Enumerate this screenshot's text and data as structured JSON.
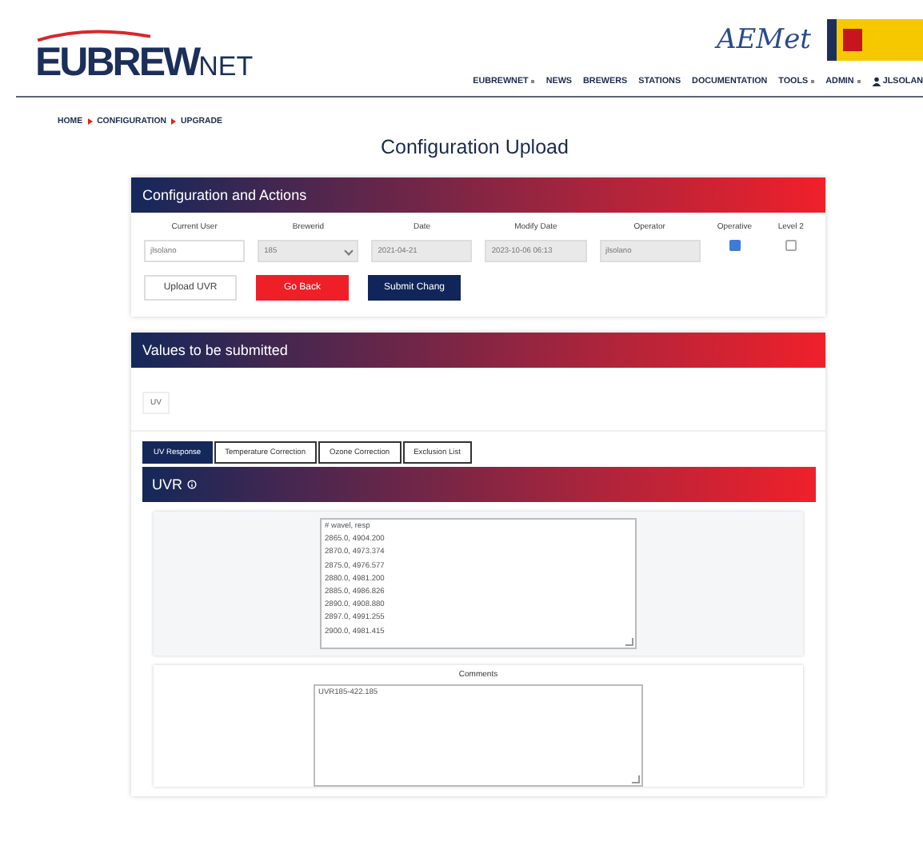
{
  "header": {
    "logo_main": "EUBREW",
    "logo_suffix": "NET",
    "partner_logo": "AEMet",
    "nav": [
      {
        "label": "EUBREWNET",
        "dropdown": true
      },
      {
        "label": "NEWS",
        "dropdown": false
      },
      {
        "label": "BREWERS",
        "dropdown": false
      },
      {
        "label": "STATIONS",
        "dropdown": false
      },
      {
        "label": "DOCUMENTATION",
        "dropdown": false
      },
      {
        "label": "TOOLS",
        "dropdown": true
      },
      {
        "label": "ADMIN",
        "dropdown": true
      }
    ],
    "user": "JLSOLAN"
  },
  "breadcrumb": [
    "HOME",
    "CONFIGURATION",
    "UPGRADE"
  ],
  "page_title": "Configuration Upload",
  "config_card": {
    "title": "Configuration and Actions",
    "fields": [
      {
        "kind": "input",
        "label": "Current User",
        "value": "jlsolano",
        "disabled": false
      },
      {
        "kind": "select",
        "label": "Brewerid",
        "value": "185",
        "disabled": true
      },
      {
        "kind": "input",
        "label": "Date",
        "value": "2021-04-21",
        "disabled": true
      },
      {
        "kind": "input",
        "label": "Modify Date",
        "value": "2023-10-06 06:13",
        "disabled": true
      },
      {
        "kind": "input",
        "label": "Operator",
        "value": "jlsolano",
        "disabled": true
      },
      {
        "kind": "checkbox",
        "label": "Operative",
        "checked": true
      },
      {
        "kind": "checkbox",
        "label": "Level 2",
        "checked": false
      }
    ],
    "buttons": [
      {
        "label": "Upload UVR",
        "kind": "outline"
      },
      {
        "label": "Go Back",
        "kind": "danger"
      },
      {
        "label": "Submit Chang",
        "kind": "primary"
      }
    ]
  },
  "values_card": {
    "title": "Values to be submitted",
    "chip": "UV",
    "tabs": [
      {
        "label": "UV Response",
        "selected": true
      },
      {
        "label": "Temperature Correction",
        "selected": false
      },
      {
        "label": "Ozone Correction",
        "selected": false
      },
      {
        "label": "Exclusion List",
        "selected": false
      }
    ],
    "section_title": "UVR",
    "data_lines": [
      "# wavel, resp",
      "2865.0, 4904.200",
      "2870.0, 4973.374",
      "2875.0, 4976.577",
      "2880.0, 4981.200",
      "2885.0, 4986.826",
      "2890.0, 4908.880",
      "2897.0, 4991.255",
      "2900.0, 4981.415"
    ],
    "comments_label": "Comments",
    "comments_value": "UVR185-422.185"
  }
}
